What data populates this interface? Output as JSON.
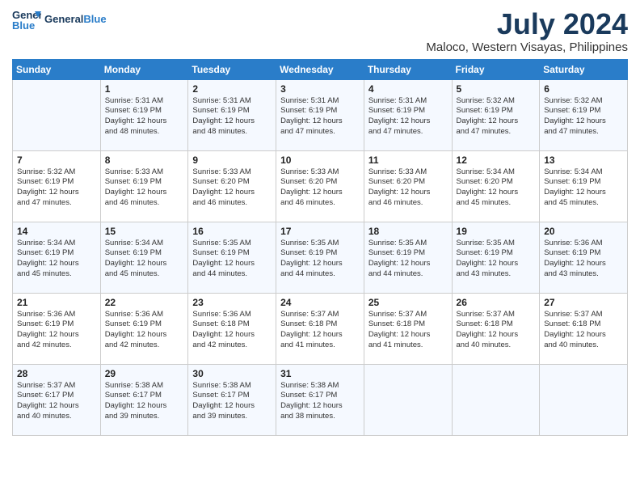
{
  "header": {
    "logo_line1": "General",
    "logo_line2": "Blue",
    "month": "July 2024",
    "location": "Maloco, Western Visayas, Philippines"
  },
  "days_of_week": [
    "Sunday",
    "Monday",
    "Tuesday",
    "Wednesday",
    "Thursday",
    "Friday",
    "Saturday"
  ],
  "weeks": [
    [
      {
        "day": "",
        "lines": []
      },
      {
        "day": "1",
        "lines": [
          "Sunrise: 5:31 AM",
          "Sunset: 6:19 PM",
          "Daylight: 12 hours",
          "and 48 minutes."
        ]
      },
      {
        "day": "2",
        "lines": [
          "Sunrise: 5:31 AM",
          "Sunset: 6:19 PM",
          "Daylight: 12 hours",
          "and 48 minutes."
        ]
      },
      {
        "day": "3",
        "lines": [
          "Sunrise: 5:31 AM",
          "Sunset: 6:19 PM",
          "Daylight: 12 hours",
          "and 47 minutes."
        ]
      },
      {
        "day": "4",
        "lines": [
          "Sunrise: 5:31 AM",
          "Sunset: 6:19 PM",
          "Daylight: 12 hours",
          "and 47 minutes."
        ]
      },
      {
        "day": "5",
        "lines": [
          "Sunrise: 5:32 AM",
          "Sunset: 6:19 PM",
          "Daylight: 12 hours",
          "and 47 minutes."
        ]
      },
      {
        "day": "6",
        "lines": [
          "Sunrise: 5:32 AM",
          "Sunset: 6:19 PM",
          "Daylight: 12 hours",
          "and 47 minutes."
        ]
      }
    ],
    [
      {
        "day": "7",
        "lines": [
          "Sunrise: 5:32 AM",
          "Sunset: 6:19 PM",
          "Daylight: 12 hours",
          "and 47 minutes."
        ]
      },
      {
        "day": "8",
        "lines": [
          "Sunrise: 5:33 AM",
          "Sunset: 6:19 PM",
          "Daylight: 12 hours",
          "and 46 minutes."
        ]
      },
      {
        "day": "9",
        "lines": [
          "Sunrise: 5:33 AM",
          "Sunset: 6:20 PM",
          "Daylight: 12 hours",
          "and 46 minutes."
        ]
      },
      {
        "day": "10",
        "lines": [
          "Sunrise: 5:33 AM",
          "Sunset: 6:20 PM",
          "Daylight: 12 hours",
          "and 46 minutes."
        ]
      },
      {
        "day": "11",
        "lines": [
          "Sunrise: 5:33 AM",
          "Sunset: 6:20 PM",
          "Daylight: 12 hours",
          "and 46 minutes."
        ]
      },
      {
        "day": "12",
        "lines": [
          "Sunrise: 5:34 AM",
          "Sunset: 6:20 PM",
          "Daylight: 12 hours",
          "and 45 minutes."
        ]
      },
      {
        "day": "13",
        "lines": [
          "Sunrise: 5:34 AM",
          "Sunset: 6:19 PM",
          "Daylight: 12 hours",
          "and 45 minutes."
        ]
      }
    ],
    [
      {
        "day": "14",
        "lines": [
          "Sunrise: 5:34 AM",
          "Sunset: 6:19 PM",
          "Daylight: 12 hours",
          "and 45 minutes."
        ]
      },
      {
        "day": "15",
        "lines": [
          "Sunrise: 5:34 AM",
          "Sunset: 6:19 PM",
          "Daylight: 12 hours",
          "and 45 minutes."
        ]
      },
      {
        "day": "16",
        "lines": [
          "Sunrise: 5:35 AM",
          "Sunset: 6:19 PM",
          "Daylight: 12 hours",
          "and 44 minutes."
        ]
      },
      {
        "day": "17",
        "lines": [
          "Sunrise: 5:35 AM",
          "Sunset: 6:19 PM",
          "Daylight: 12 hours",
          "and 44 minutes."
        ]
      },
      {
        "day": "18",
        "lines": [
          "Sunrise: 5:35 AM",
          "Sunset: 6:19 PM",
          "Daylight: 12 hours",
          "and 44 minutes."
        ]
      },
      {
        "day": "19",
        "lines": [
          "Sunrise: 5:35 AM",
          "Sunset: 6:19 PM",
          "Daylight: 12 hours",
          "and 43 minutes."
        ]
      },
      {
        "day": "20",
        "lines": [
          "Sunrise: 5:36 AM",
          "Sunset: 6:19 PM",
          "Daylight: 12 hours",
          "and 43 minutes."
        ]
      }
    ],
    [
      {
        "day": "21",
        "lines": [
          "Sunrise: 5:36 AM",
          "Sunset: 6:19 PM",
          "Daylight: 12 hours",
          "and 42 minutes."
        ]
      },
      {
        "day": "22",
        "lines": [
          "Sunrise: 5:36 AM",
          "Sunset: 6:19 PM",
          "Daylight: 12 hours",
          "and 42 minutes."
        ]
      },
      {
        "day": "23",
        "lines": [
          "Sunrise: 5:36 AM",
          "Sunset: 6:18 PM",
          "Daylight: 12 hours",
          "and 42 minutes."
        ]
      },
      {
        "day": "24",
        "lines": [
          "Sunrise: 5:37 AM",
          "Sunset: 6:18 PM",
          "Daylight: 12 hours",
          "and 41 minutes."
        ]
      },
      {
        "day": "25",
        "lines": [
          "Sunrise: 5:37 AM",
          "Sunset: 6:18 PM",
          "Daylight: 12 hours",
          "and 41 minutes."
        ]
      },
      {
        "day": "26",
        "lines": [
          "Sunrise: 5:37 AM",
          "Sunset: 6:18 PM",
          "Daylight: 12 hours",
          "and 40 minutes."
        ]
      },
      {
        "day": "27",
        "lines": [
          "Sunrise: 5:37 AM",
          "Sunset: 6:18 PM",
          "Daylight: 12 hours",
          "and 40 minutes."
        ]
      }
    ],
    [
      {
        "day": "28",
        "lines": [
          "Sunrise: 5:37 AM",
          "Sunset: 6:17 PM",
          "Daylight: 12 hours",
          "and 40 minutes."
        ]
      },
      {
        "day": "29",
        "lines": [
          "Sunrise: 5:38 AM",
          "Sunset: 6:17 PM",
          "Daylight: 12 hours",
          "and 39 minutes."
        ]
      },
      {
        "day": "30",
        "lines": [
          "Sunrise: 5:38 AM",
          "Sunset: 6:17 PM",
          "Daylight: 12 hours",
          "and 39 minutes."
        ]
      },
      {
        "day": "31",
        "lines": [
          "Sunrise: 5:38 AM",
          "Sunset: 6:17 PM",
          "Daylight: 12 hours",
          "and 38 minutes."
        ]
      },
      {
        "day": "",
        "lines": []
      },
      {
        "day": "",
        "lines": []
      },
      {
        "day": "",
        "lines": []
      }
    ]
  ]
}
